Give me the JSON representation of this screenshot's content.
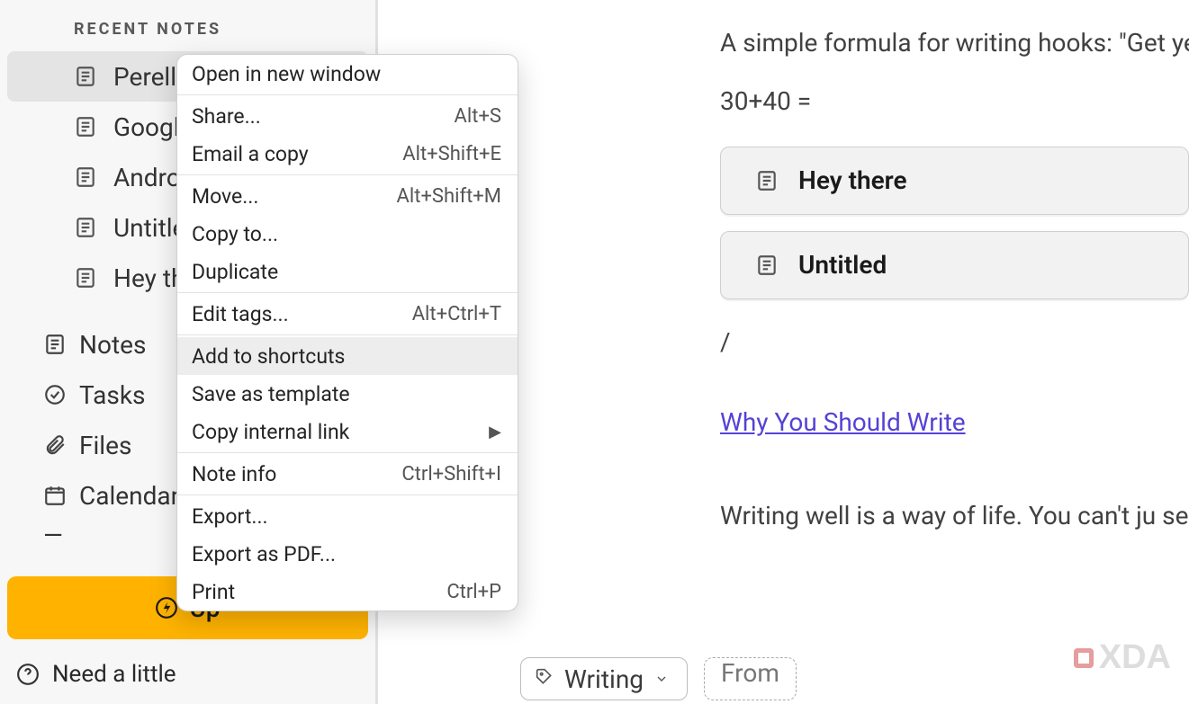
{
  "sidebar": {
    "section_heading": "RECENT NOTES",
    "recent": [
      {
        "label": "Perell",
        "selected": true
      },
      {
        "label": "Google",
        "selected": false
      },
      {
        "label": "Android",
        "selected": false
      },
      {
        "label": "Untitled",
        "selected": false
      },
      {
        "label": "Hey the",
        "selected": false
      }
    ],
    "nav": [
      {
        "label": "Notes",
        "icon": "note-icon"
      },
      {
        "label": "Tasks",
        "icon": "check-circle-icon"
      },
      {
        "label": "Files",
        "icon": "paperclip-icon"
      },
      {
        "label": "Calendar",
        "icon": "calendar-icon"
      }
    ],
    "upgrade_label": "Up",
    "help_label": "Need a little "
  },
  "context_menu": {
    "groups": [
      [
        {
          "label": "Open in new window",
          "shortcut": ""
        }
      ],
      [
        {
          "label": "Share...",
          "shortcut": "Alt+S"
        },
        {
          "label": "Email a copy",
          "shortcut": "Alt+Shift+E"
        }
      ],
      [
        {
          "label": "Move...",
          "shortcut": "Alt+Shift+M"
        },
        {
          "label": "Copy to...",
          "shortcut": ""
        },
        {
          "label": "Duplicate",
          "shortcut": ""
        }
      ],
      [
        {
          "label": "Edit tags...",
          "shortcut": "Alt+Ctrl+T"
        }
      ],
      [
        {
          "label": "Add to shortcuts",
          "shortcut": "",
          "hover": true
        },
        {
          "label": "Save as template",
          "shortcut": ""
        },
        {
          "label": "Copy internal link",
          "shortcut": "",
          "submenu": true
        }
      ],
      [
        {
          "label": "Note info",
          "shortcut": "Ctrl+Shift+I"
        }
      ],
      [
        {
          "label": "Export...",
          "shortcut": ""
        },
        {
          "label": "Export as PDF...",
          "shortcut": ""
        },
        {
          "label": "Print",
          "shortcut": "Ctrl+P"
        }
      ]
    ]
  },
  "note": {
    "para1": "A simple formula for writing hooks: \"Get yes to the headline, subheading, and fir they're ready for an interesting and com",
    "calc": "30+40 =",
    "linked_notes": [
      {
        "label": "Hey there"
      },
      {
        "label": "Untitled"
      }
    ],
    "slash": "/",
    "link_text": "Why You Should Write",
    "para2": "Writing well is a way of life. You can't ju sentences. To write well, you have to liv"
  },
  "tags": {
    "chip_label": "Writing",
    "input_placeholder": "From"
  },
  "watermark": "XDA"
}
